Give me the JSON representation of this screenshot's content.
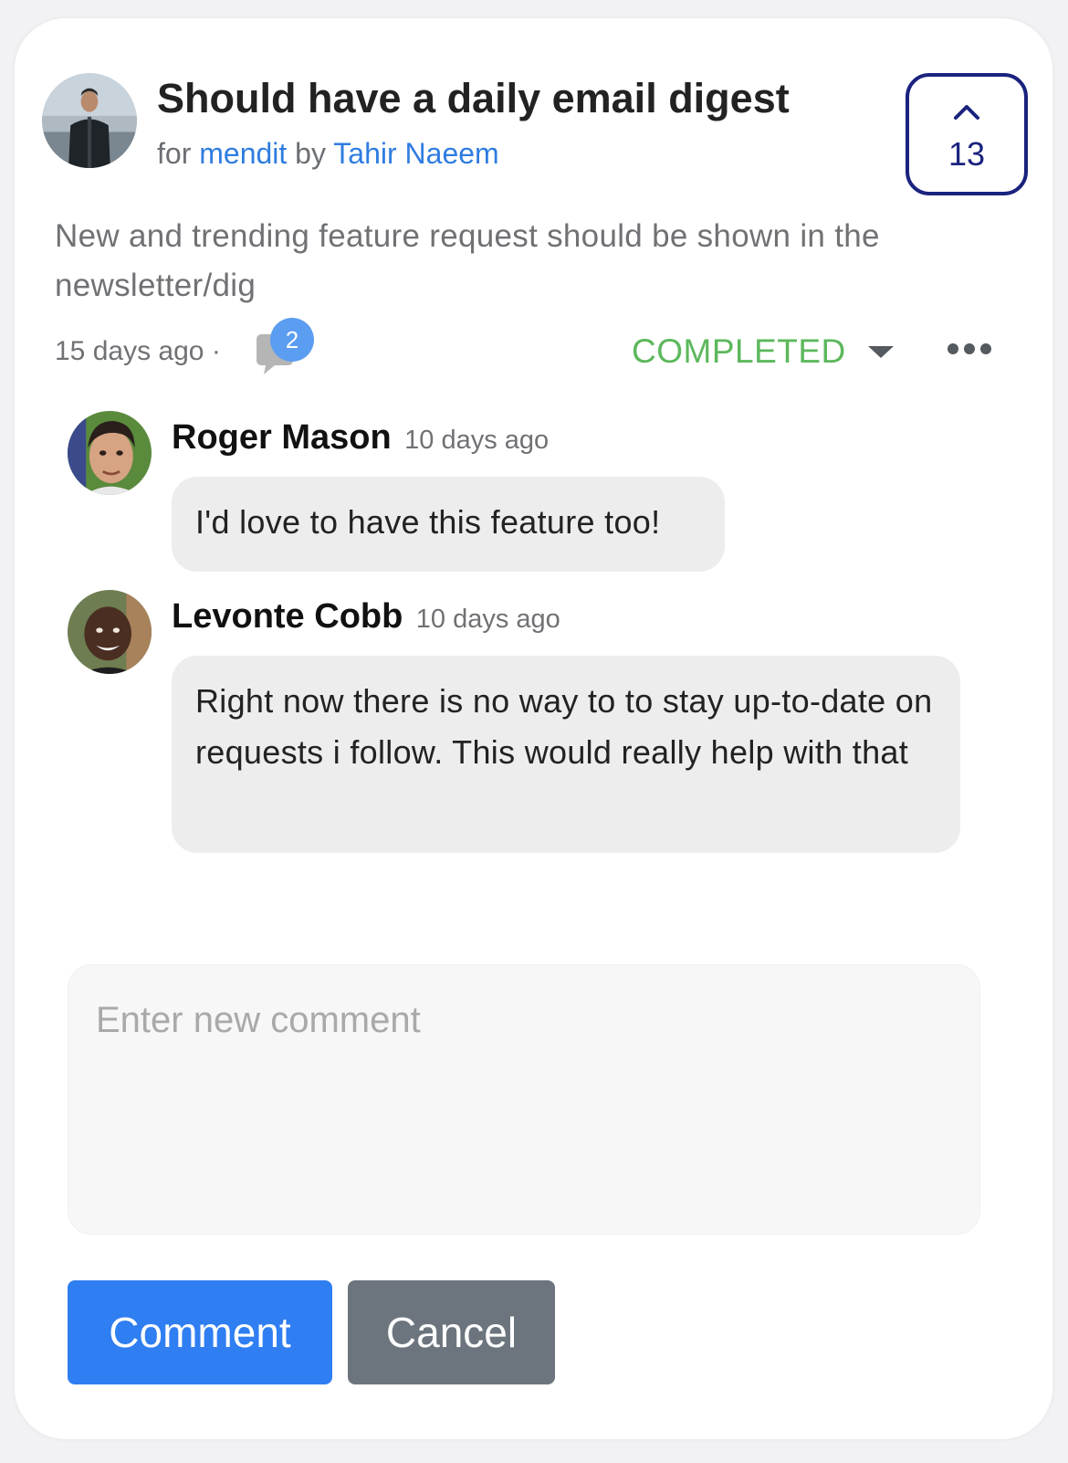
{
  "post": {
    "title": "Should have a daily email digest",
    "meta_for": "for",
    "board": "mendit",
    "meta_by": "by",
    "author": "Tahir Naeem",
    "body": "New and trending feature request should be shown in the newsletter/dig",
    "time": "15 days ago",
    "separator": "·",
    "comment_count": "2",
    "votes": "13",
    "status": "COMPLETED"
  },
  "comments": [
    {
      "author": "Roger Mason",
      "time": "10 days ago",
      "text": "I'd love to have this feature too!"
    },
    {
      "author": "Levonte Cobb",
      "time": "10 days ago",
      "text": "Right now there is no way to to stay up-to-date on requests i follow. This would really help with that"
    }
  ],
  "composer": {
    "placeholder": "Enter new comment",
    "submit_label": "Comment",
    "cancel_label": "Cancel"
  },
  "colors": {
    "link": "#2f7de0",
    "status_completed": "#5cb85c",
    "vote_border": "#1a237e",
    "primary_button": "#2f7ef2",
    "secondary_button": "#6c757d"
  },
  "icons": {
    "upvote": "chevron-up-icon",
    "comments": "speech-bubble-icon",
    "status_dropdown": "caret-down-icon",
    "more": "more-horizontal-icon"
  }
}
